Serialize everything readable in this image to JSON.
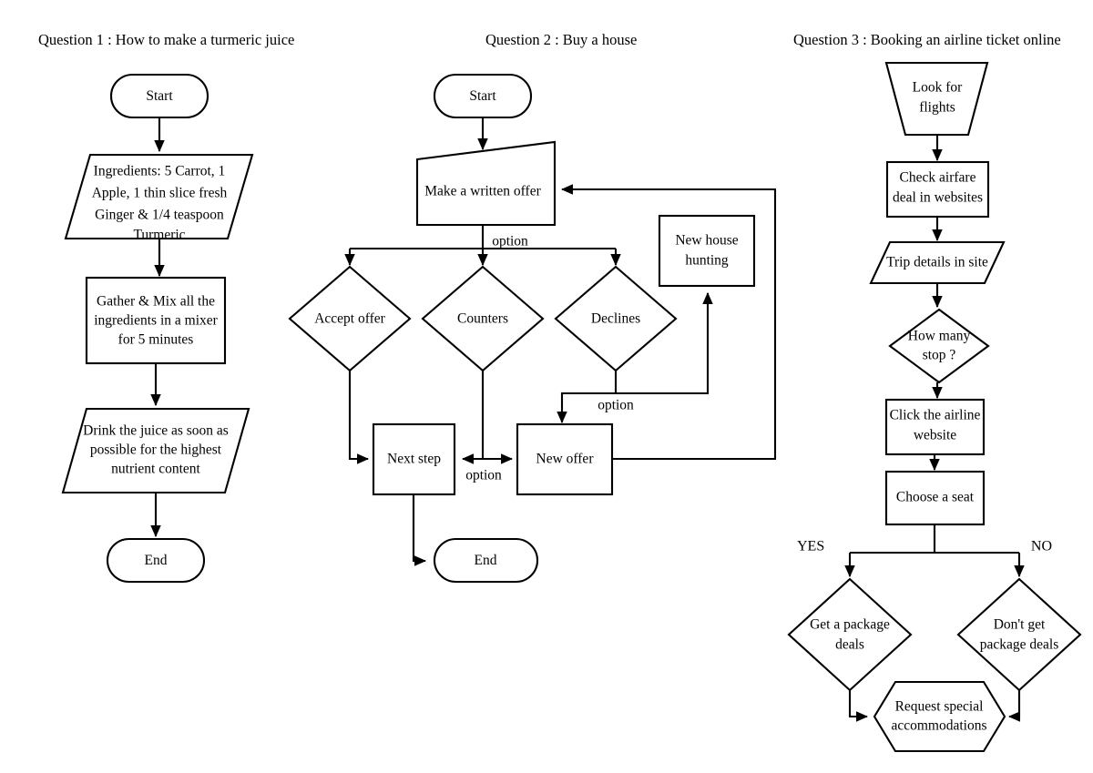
{
  "page": {
    "background_color": "#ffffff",
    "stroke_color": "#000000",
    "text_color": "#000000"
  },
  "columns": [
    {
      "id": "question-1",
      "title": "Question 1 : How to make a turmeric juice",
      "nodes": {
        "start": "Start",
        "ingredients": "Ingredients: 5 Carrot, 1 Apple, 1 thin slice fresh Ginger & 1/4 teaspoon Turmeric",
        "ingredients_lines": [
          "Ingredients: 5 Carrot, 1",
          "Apple, 1 thin slice fresh",
          "Ginger & 1/4 teaspoon",
          "Turmeric"
        ],
        "mix": "Gather & Mix all the ingredients in a mixer for 5 minutes",
        "mix_lines": [
          "Gather & Mix all the",
          "ingredients in a mixer",
          "for 5 minutes"
        ],
        "drink": "Drink the juice as soon as possible for the highest nutrient content",
        "drink_lines": [
          "Drink the juice as soon as",
          "possible for the highest",
          "nutrient content"
        ],
        "end": "End"
      }
    },
    {
      "id": "question-2",
      "title": "Question 2 : Buy a house",
      "nodes": {
        "start": "Start",
        "written_offer": "Make a written offer",
        "accept_offer": "Accept offer",
        "counters": "Counters",
        "declines": "Declines",
        "new_house_hunting": "New house hunting",
        "new_house_hunting_lines": [
          "New house",
          "hunting"
        ],
        "next_step": "Next step",
        "new_offer": "New offer",
        "end": "End"
      },
      "edge_labels": {
        "option_top": "option",
        "option_declines": "option",
        "option_counters": "option"
      }
    },
    {
      "id": "question-3",
      "title": "Question 3 : Booking an airline ticket online",
      "nodes": {
        "look_for_flights": "Look for flights",
        "look_for_flights_lines": [
          "Look for",
          "flights"
        ],
        "check_airfare": "Check airfare deal in websites",
        "check_airfare_lines": [
          "Check airfare",
          "deal in websites"
        ],
        "trip_details": "Trip details in site",
        "how_many_stop": "How many stop ?",
        "how_many_stop_lines": [
          "How many",
          "stop ?"
        ],
        "click_airline": "Click the airline website",
        "click_airline_lines": [
          "Click the airline",
          "website"
        ],
        "choose_seat": "Choose a seat",
        "get_package": "Get a package deals",
        "get_package_lines": [
          "Get a package",
          "deals"
        ],
        "dont_get_package": "Don't get package deals",
        "dont_get_package_lines": [
          "Don't get",
          "package deals"
        ],
        "request_special": "Request special accommodations",
        "request_special_lines": [
          "Request special",
          "accommodations"
        ]
      },
      "branch_labels": {
        "yes": "YES",
        "no": "NO"
      }
    }
  ]
}
